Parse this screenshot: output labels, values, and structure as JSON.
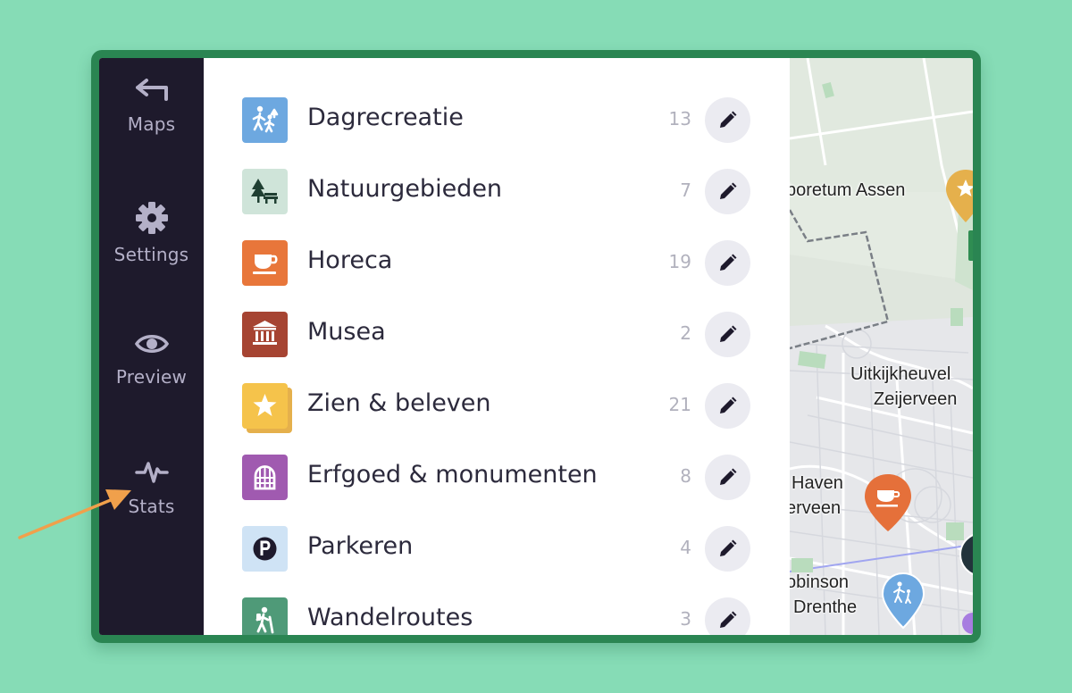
{
  "sidebar": {
    "items": [
      {
        "label": "Maps",
        "icon": "back-arrow-icon"
      },
      {
        "label": "Settings",
        "icon": "gear-icon"
      },
      {
        "label": "Preview",
        "icon": "eye-icon"
      },
      {
        "label": "Stats",
        "icon": "pulse-icon"
      }
    ]
  },
  "categories": [
    {
      "name": "Dagrecreatie",
      "count": "13",
      "icon": "family-walk-icon",
      "color": "#6da8e0"
    },
    {
      "name": "Natuurgebieden",
      "count": "7",
      "icon": "tree-bench-icon",
      "color": "#cfe4d9"
    },
    {
      "name": "Horeca",
      "count": "19",
      "icon": "coffee-cup-icon",
      "color": "#e8763a"
    },
    {
      "name": "Musea",
      "count": "2",
      "icon": "museum-icon",
      "color": "#a64432"
    },
    {
      "name": "Zien & beleven",
      "count": "21",
      "icon": "star-icon",
      "color": "#f5c34b"
    },
    {
      "name": "Erfgoed & monumenten",
      "count": "8",
      "icon": "arched-window-icon",
      "color": "#a05ab0"
    },
    {
      "name": "Parkeren",
      "count": "4",
      "icon": "parking-icon",
      "color": "#cfe3f5"
    },
    {
      "name": "Wandelroutes",
      "count": "3",
      "icon": "hiker-icon",
      "color": "#4f9a78"
    }
  ],
  "map": {
    "labels": [
      "boretum Assen",
      "Uitkijkheuvel",
      "Zeijerveen",
      "Haven",
      "erveen",
      "obinson",
      "Drenthe"
    ]
  },
  "colors": {
    "background": "#86dcb6",
    "frame": "#2a8552",
    "sidebar": "#1e1a2c",
    "annotation_arrow": "#f0a04b"
  }
}
